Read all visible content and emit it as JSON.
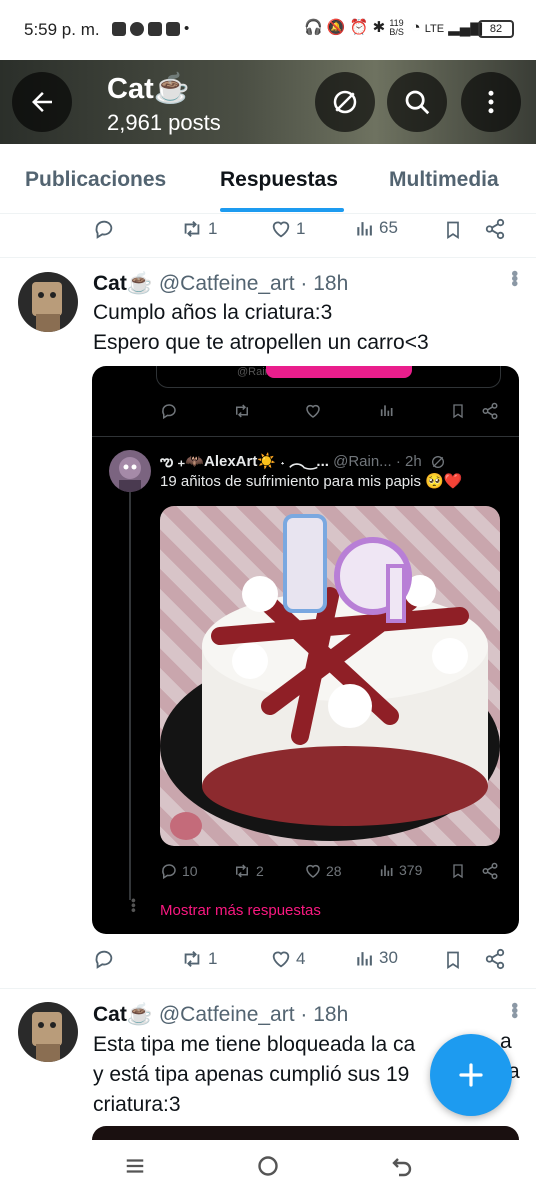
{
  "status_bar": {
    "time": "5:59 p. m.",
    "network_speed": "119\nB/S",
    "network": "LTE",
    "battery": "82"
  },
  "header": {
    "title": "Cat☕",
    "posts_count": "2,961 posts",
    "back_icon": "back-arrow-icon",
    "grok_icon": "slash-circle-icon",
    "search_icon": "search-icon",
    "more_icon": "more-vertical-icon"
  },
  "tabs": [
    {
      "label": "Publicaciones"
    },
    {
      "label": "Respuestas"
    },
    {
      "label": "Multimedia"
    }
  ],
  "prev_post_actions": {
    "replies": "",
    "retweets": "1",
    "likes": "1",
    "views": "65"
  },
  "posts": [
    {
      "name": "Cat☕",
      "handle": "@Catfeine_art · 18h",
      "lines": [
        "Cumplo años la criatura:3",
        "Espero que te atropellen un carro<3"
      ],
      "actions": {
        "replies": "",
        "retweets": "1",
        "likes": "4",
        "views": "30"
      }
    },
    {
      "name": "Cat☕",
      "handle": "@Catfeine_art · 18h",
      "lines": [
        "Esta tipa me tiene bloqueada la ca",
        "y está tipa apenas cumplió sus 19",
        "criatura:3"
      ],
      "line_tails": [
        "a",
        "a",
        ""
      ]
    }
  ],
  "quote": {
    "top_card_text": "@Rainbo",
    "name": "ఌ︎ ₊🦇AlexArt☀️ ˖  ︵‿...",
    "handle": "@Rain...",
    "time": "· 2h",
    "text": "19 añitos de sufrimiento para mis papis 🥺❤️",
    "actions": {
      "replies": "10",
      "retweets": "2",
      "likes": "28",
      "views": "379"
    },
    "show_more": "Mostrar más respuestas"
  },
  "colors": {
    "accent": "#1d9bf0",
    "pink": "#f91880",
    "text": "#0f1419",
    "muted": "#536471"
  }
}
